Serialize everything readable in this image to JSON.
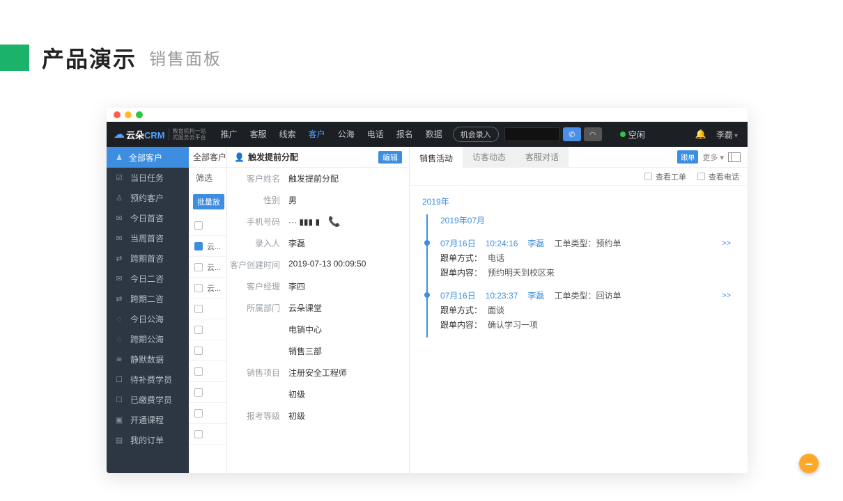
{
  "page": {
    "title": "产品演示",
    "subtitle": "销售面板"
  },
  "logo": {
    "brand": "云朵",
    "crm": "CRM",
    "sub1": "教育机构一站",
    "sub2": "式服务云平台"
  },
  "topnav": [
    "推广",
    "客服",
    "线索",
    "客户",
    "公海",
    "电话",
    "报名",
    "数据"
  ],
  "topnav_active_index": 3,
  "opportunity_btn": "机会录入",
  "status_text": "空闲",
  "user_name": "李磊",
  "sidebar_head": "全部客户",
  "sidebar": [
    {
      "icon": "☑",
      "label": "当日任务"
    },
    {
      "icon": "♙",
      "label": "预约客户"
    },
    {
      "icon": "✉",
      "label": "今日首咨"
    },
    {
      "icon": "✉",
      "label": "当周首咨"
    },
    {
      "icon": "⇄",
      "label": "跨期首咨"
    },
    {
      "icon": "✉",
      "label": "今日二咨"
    },
    {
      "icon": "⇄",
      "label": "跨期二咨"
    },
    {
      "icon": "◌",
      "label": "今日公海"
    },
    {
      "icon": "◌",
      "label": "跨期公海"
    },
    {
      "icon": "≋",
      "label": "静默数据"
    },
    {
      "icon": "☐",
      "label": "待补费学员"
    },
    {
      "icon": "☐",
      "label": "已缴费学员"
    },
    {
      "icon": "▣",
      "label": "开通课程"
    },
    {
      "icon": "▤",
      "label": "我的订单"
    }
  ],
  "list": {
    "title": "全部客户",
    "filter_label": "筛选",
    "batch_btn": "批量放",
    "rows": [
      "",
      "云...",
      "云...",
      "云...",
      "",
      "",
      "",
      "",
      "",
      "",
      ""
    ],
    "selected_index": 1
  },
  "detail": {
    "header_icon": "👤",
    "header_title": "触发提前分配",
    "edit_btn": "编辑",
    "fields": [
      {
        "k": "客户姓名",
        "v": "触发提前分配"
      },
      {
        "k": "性别",
        "v": "男"
      },
      {
        "k": "手机号码",
        "v": "··· ▮▮▮ ▮",
        "phone": true
      },
      {
        "k": "录入人",
        "v": "李磊"
      },
      {
        "k": "客户创建时间",
        "v": "2019-07-13 00:09:50"
      },
      {
        "k": "客户经理",
        "v": "李四"
      },
      {
        "k": "所属部门",
        "v": "云朵课堂"
      },
      {
        "k": "",
        "v": "电销中心"
      },
      {
        "k": "",
        "v": "销售三部"
      },
      {
        "k": "销售项目",
        "v": "注册安全工程师"
      },
      {
        "k": "",
        "v": "初级"
      },
      {
        "k": "报考等级",
        "v": "初级"
      }
    ]
  },
  "activity": {
    "tabs": [
      "销售活动",
      "访客动态",
      "客服对话"
    ],
    "active_tab": 0,
    "follow_tag": "跟单",
    "more_label": "更多 ▾",
    "toolbar": [
      "查看工单",
      "查看电话"
    ],
    "year": "2019年",
    "month": "2019年07月",
    "entries": [
      {
        "date": "07月16日",
        "time": "10:24:16",
        "user": "李磊",
        "type_label": "工单类型：",
        "type": "预约单",
        "lines": [
          {
            "lbl": "跟单方式：",
            "val": "电话"
          },
          {
            "lbl": "跟单内容：",
            "val": "预约明天到校区来"
          }
        ],
        "more": ">>"
      },
      {
        "date": "07月16日",
        "time": "10:23:37",
        "user": "李磊",
        "type_label": "工单类型：",
        "type": "回访单",
        "lines": [
          {
            "lbl": "跟单方式：",
            "val": "面谈"
          },
          {
            "lbl": "跟单内容：",
            "val": "确认学习一项"
          }
        ],
        "more": ">>"
      }
    ]
  }
}
